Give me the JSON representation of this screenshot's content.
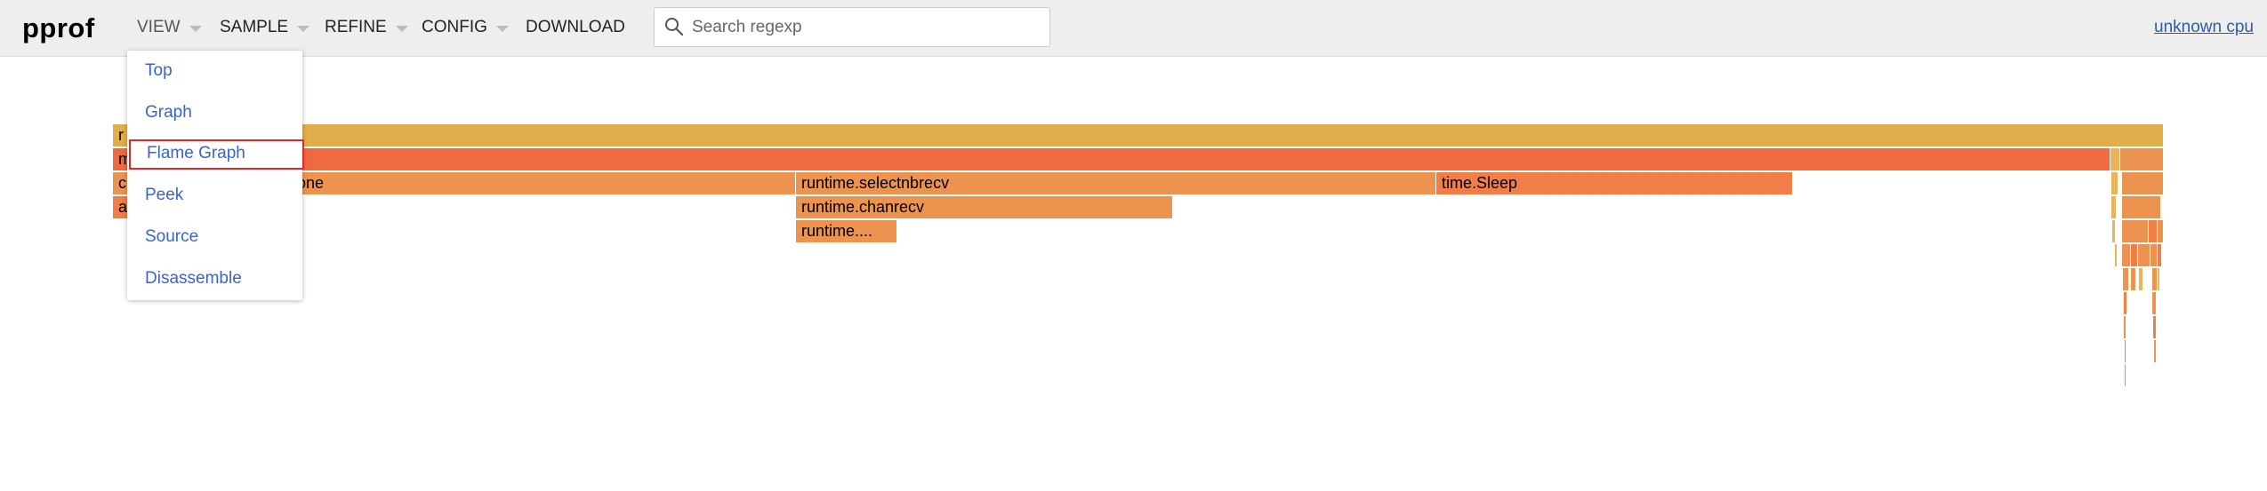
{
  "header": {
    "logo": "pprof",
    "menus": [
      {
        "label": "VIEW",
        "has_caret": true
      },
      {
        "label": "SAMPLE",
        "has_caret": true
      },
      {
        "label": "REFINE",
        "has_caret": true
      },
      {
        "label": "CONFIG",
        "has_caret": true
      },
      {
        "label": "DOWNLOAD",
        "has_caret": false
      }
    ],
    "search": {
      "placeholder": "Search regexp",
      "value": ""
    },
    "profile_link": "unknown cpu"
  },
  "view_menu": {
    "items": [
      "Top",
      "Graph",
      "Flame Graph",
      "Peek",
      "Source",
      "Disassemble"
    ],
    "selected": "Flame Graph"
  },
  "flame_graph": {
    "frames": [
      {
        "label": "r",
        "depth": 0
      },
      {
        "label": "m",
        "depth": 1
      },
      {
        "label": "c",
        "depth": 2
      },
      {
        "label": "one",
        "depth": 2
      },
      {
        "label": "runtime.selectnbrecv",
        "depth": 2
      },
      {
        "label": "time.Sleep",
        "depth": 2
      },
      {
        "label": "a",
        "depth": 3
      },
      {
        "label": "runtime.chanrecv",
        "depth": 3
      },
      {
        "label": "runtime....",
        "depth": 4
      }
    ]
  },
  "colors": {
    "header_bg": "#eeeeee",
    "link": "#2a5db0",
    "menu_item": "#3a64c8",
    "highlight_border": "#e8262a",
    "frame_root": "#e1ae4e",
    "frame_hot": "#f06a40",
    "frame_warm": "#ec9350",
    "frame_orange": "#f27d47"
  }
}
